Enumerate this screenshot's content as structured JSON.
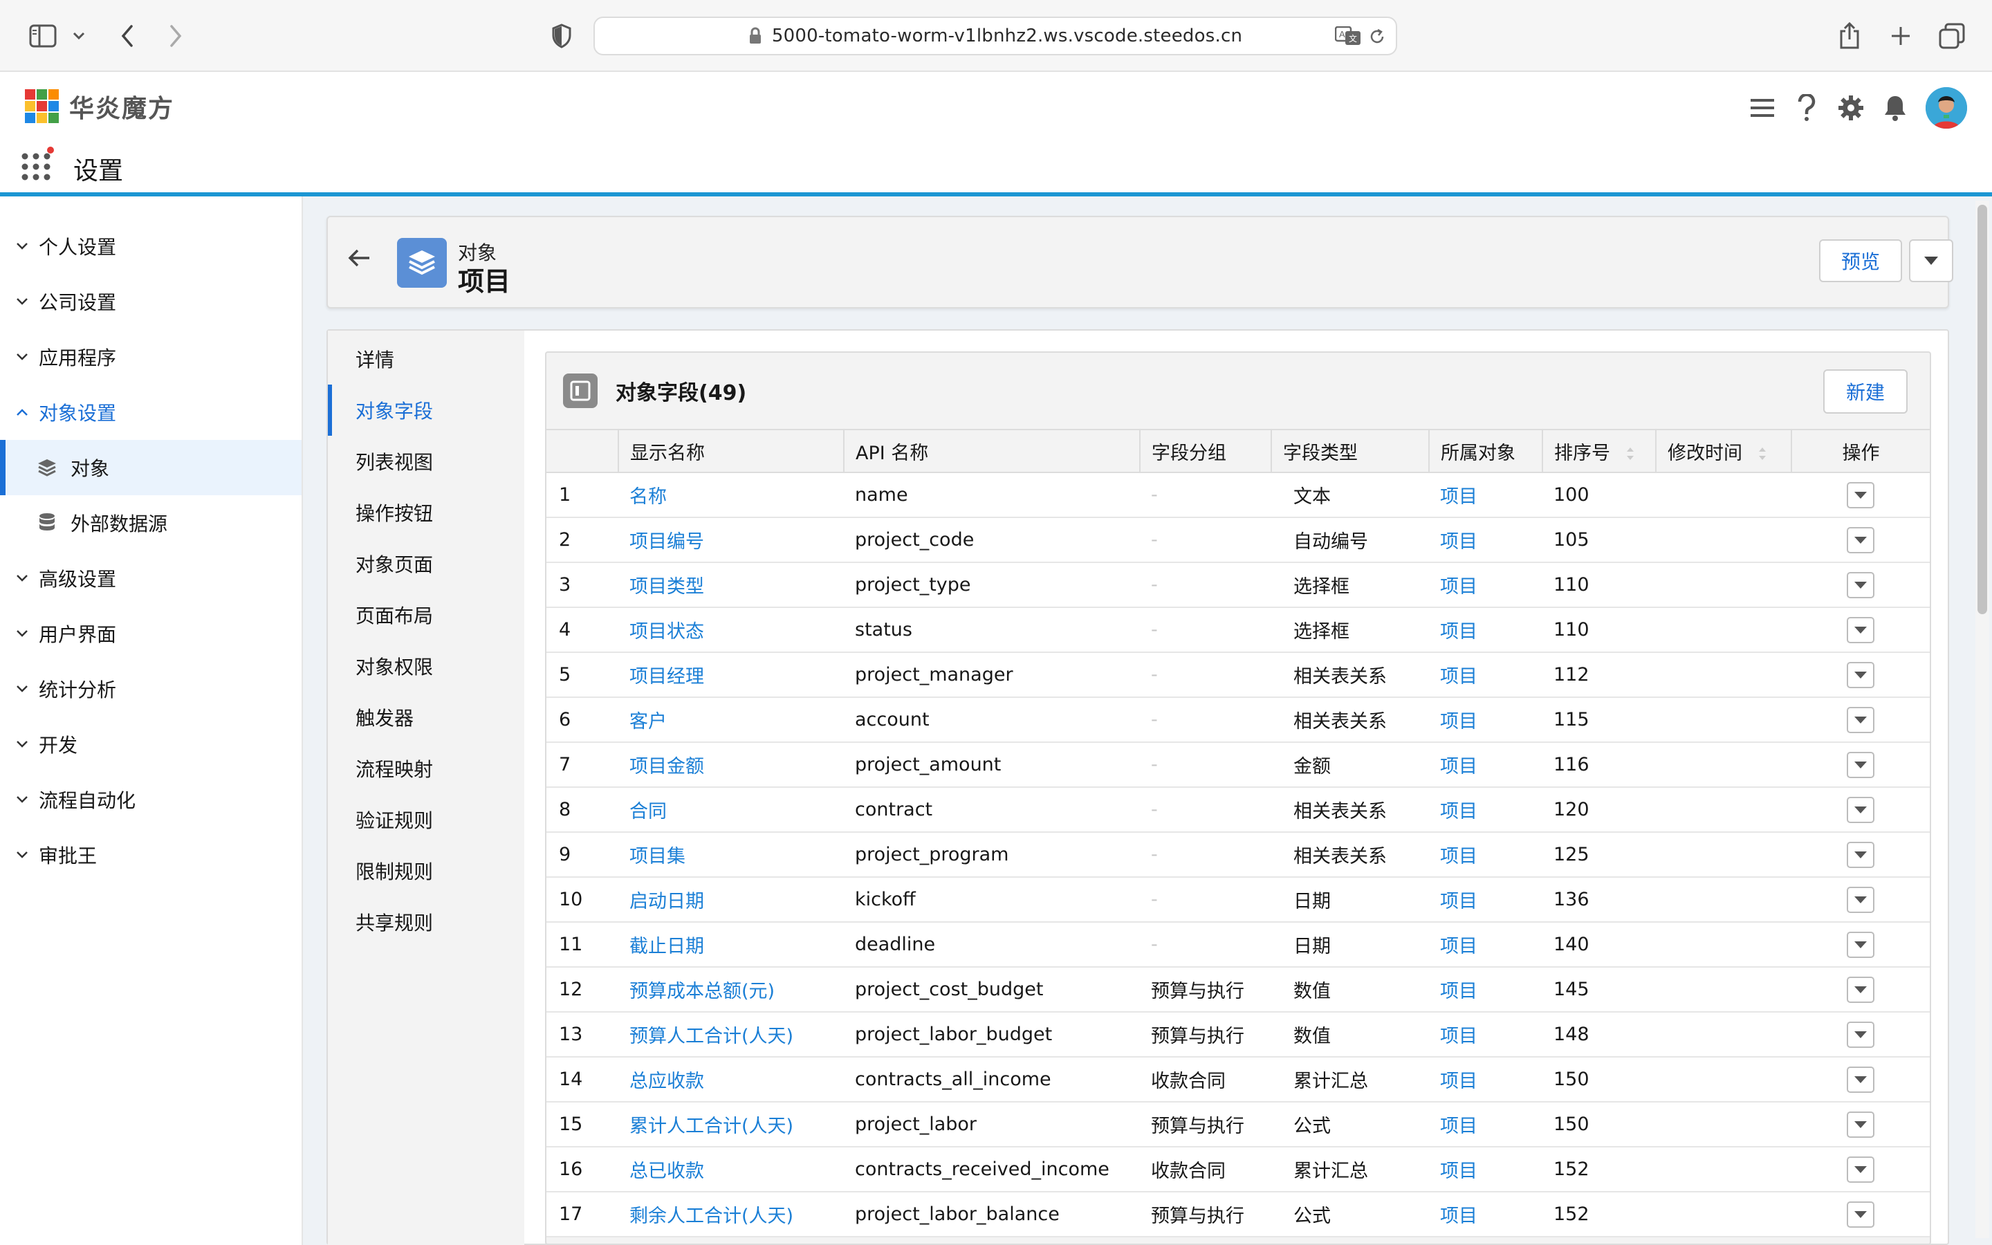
{
  "browser": {
    "url": "5000-tomato-worm-v1lbnhz2.ws.vscode.steedos.cn",
    "icons": [
      "sidebar-toggle-icon",
      "chevron-down-icon",
      "back-icon",
      "forward-icon",
      "shield-icon",
      "lock-icon",
      "translate-icon",
      "reload-icon",
      "share-icon",
      "new-tab-icon",
      "tabs-overview-icon"
    ]
  },
  "app": {
    "brand": "华炎魔方",
    "title": "设置",
    "header_icons": [
      "menu-icon",
      "help-icon",
      "gear-icon",
      "bell-icon",
      "avatar"
    ]
  },
  "sidebar": {
    "items": [
      {
        "label": "个人设置"
      },
      {
        "label": "公司设置"
      },
      {
        "label": "应用程序"
      },
      {
        "label": "对象设置"
      },
      {
        "label": "高级设置"
      },
      {
        "label": "用户界面"
      },
      {
        "label": "统计分析"
      },
      {
        "label": "开发"
      },
      {
        "label": "流程自动化"
      },
      {
        "label": "审批王"
      }
    ],
    "subitems": [
      {
        "label": "对象",
        "icon": "layers-icon"
      },
      {
        "label": "外部数据源",
        "icon": "database-icon"
      }
    ]
  },
  "object_header": {
    "type_label": "对象",
    "name": "项目",
    "preview_label": "预览"
  },
  "subnav": {
    "items": [
      {
        "label": "详情"
      },
      {
        "label": "对象字段"
      },
      {
        "label": "列表视图"
      },
      {
        "label": "操作按钮"
      },
      {
        "label": "对象页面"
      },
      {
        "label": "页面布局"
      },
      {
        "label": "对象权限"
      },
      {
        "label": "触发器"
      },
      {
        "label": "流程映射"
      },
      {
        "label": "验证规则"
      },
      {
        "label": "限制规则"
      },
      {
        "label": "共享规则"
      }
    ]
  },
  "fields_card": {
    "title": "对象字段(49)",
    "new_label": "新建",
    "columns": [
      "显示名称",
      "API 名称",
      "字段分组",
      "字段类型",
      "所属对象",
      "排序号",
      "修改时间",
      "操作"
    ],
    "rows": [
      {
        "no": "1",
        "label": "名称",
        "api": "name",
        "group": "-",
        "type": "文本",
        "object": "项目",
        "sort": "100"
      },
      {
        "no": "2",
        "label": "项目编号",
        "api": "project_code",
        "group": "-",
        "type": "自动编号",
        "object": "项目",
        "sort": "105"
      },
      {
        "no": "3",
        "label": "项目类型",
        "api": "project_type",
        "group": "-",
        "type": "选择框",
        "object": "项目",
        "sort": "110"
      },
      {
        "no": "4",
        "label": "项目状态",
        "api": "status",
        "group": "-",
        "type": "选择框",
        "object": "项目",
        "sort": "110"
      },
      {
        "no": "5",
        "label": "项目经理",
        "api": "project_manager",
        "group": "-",
        "type": "相关表关系",
        "object": "项目",
        "sort": "112"
      },
      {
        "no": "6",
        "label": "客户",
        "api": "account",
        "group": "-",
        "type": "相关表关系",
        "object": "项目",
        "sort": "115"
      },
      {
        "no": "7",
        "label": "项目金额",
        "api": "project_amount",
        "group": "-",
        "type": "金额",
        "object": "项目",
        "sort": "116"
      },
      {
        "no": "8",
        "label": "合同",
        "api": "contract",
        "group": "-",
        "type": "相关表关系",
        "object": "项目",
        "sort": "120"
      },
      {
        "no": "9",
        "label": "项目集",
        "api": "project_program",
        "group": "-",
        "type": "相关表关系",
        "object": "项目",
        "sort": "125"
      },
      {
        "no": "10",
        "label": "启动日期",
        "api": "kickoff",
        "group": "-",
        "type": "日期",
        "object": "项目",
        "sort": "136"
      },
      {
        "no": "11",
        "label": "截止日期",
        "api": "deadline",
        "group": "-",
        "type": "日期",
        "object": "项目",
        "sort": "140"
      },
      {
        "no": "12",
        "label": "预算成本总额(元)",
        "api": "project_cost_budget",
        "group": "预算与执行",
        "type": "数值",
        "object": "项目",
        "sort": "145"
      },
      {
        "no": "13",
        "label": "预算人工合计(人天)",
        "api": "project_labor_budget",
        "group": "预算与执行",
        "type": "数值",
        "object": "项目",
        "sort": "148"
      },
      {
        "no": "14",
        "label": "总应收款",
        "api": "contracts_all_income",
        "group": "收款合同",
        "type": "累计汇总",
        "object": "项目",
        "sort": "150"
      },
      {
        "no": "15",
        "label": "累计人工合计(人天)",
        "api": "project_labor",
        "group": "预算与执行",
        "type": "公式",
        "object": "项目",
        "sort": "150"
      },
      {
        "no": "16",
        "label": "总已收款",
        "api": "contracts_received_income",
        "group": "收款合同",
        "type": "累计汇总",
        "object": "项目",
        "sort": "152"
      },
      {
        "no": "17",
        "label": "剩余人工合计(人天)",
        "api": "project_labor_balance",
        "group": "预算与执行",
        "type": "公式",
        "object": "项目",
        "sort": "152"
      }
    ]
  },
  "colors": {
    "accent": "#1b6fd6",
    "link": "#1b7fd6",
    "header_line": "#1b96d3",
    "content_bg": "#eef2f6"
  }
}
